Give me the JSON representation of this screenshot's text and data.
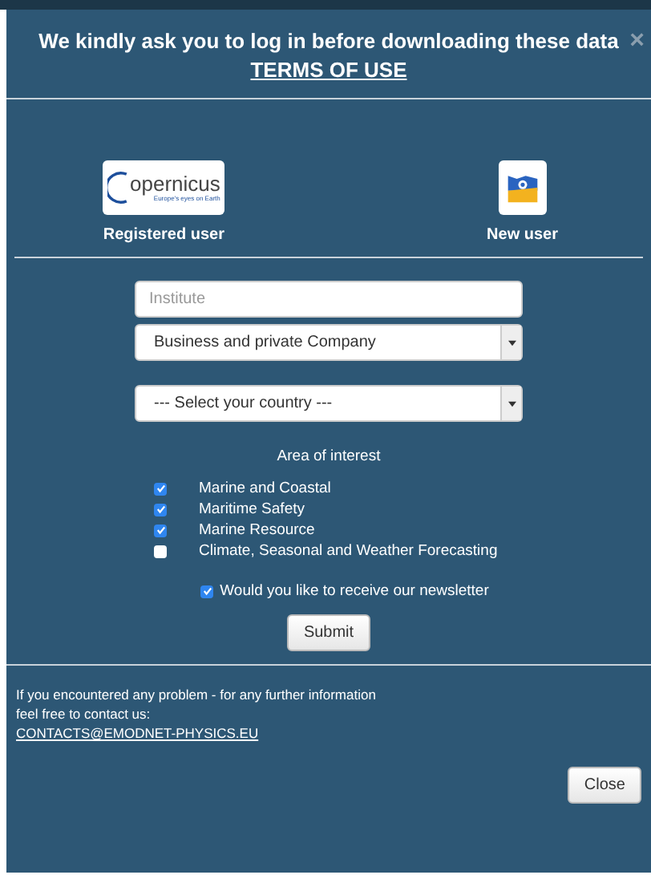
{
  "header": {
    "title": "We kindly ask you to log in before downloading these data",
    "terms_link": "TERMS OF USE",
    "close_glyph": "×"
  },
  "user_options": [
    {
      "kind": "registered",
      "logo_text": "opernicus",
      "logo_tagline": "Europe's eyes on Earth",
      "label": "Registered user"
    },
    {
      "kind": "new",
      "label": "New user"
    }
  ],
  "form": {
    "institute": {
      "placeholder": "Institute"
    },
    "category": {
      "value": "Business and private Company"
    },
    "country": {
      "value": "--- Select your country ---"
    },
    "area_heading": "Area of interest",
    "areas": [
      {
        "label": "Marine and Coastal",
        "checked": true
      },
      {
        "label": "Maritime Safety",
        "checked": true
      },
      {
        "label": "Marine Resource",
        "checked": true
      },
      {
        "label": "Climate, Seasonal and Weather Forecasting",
        "checked": false
      }
    ],
    "newsletter": {
      "label": "Would you like to receive our newsletter",
      "checked": true
    },
    "submit": "Submit"
  },
  "footer": {
    "message_lines": [
      "If you encountered any problem - for any further information",
      "feel free to contact us:"
    ],
    "email": "CONTACTS@EMODNET-PHYSICS.EU",
    "close": "Close"
  }
}
